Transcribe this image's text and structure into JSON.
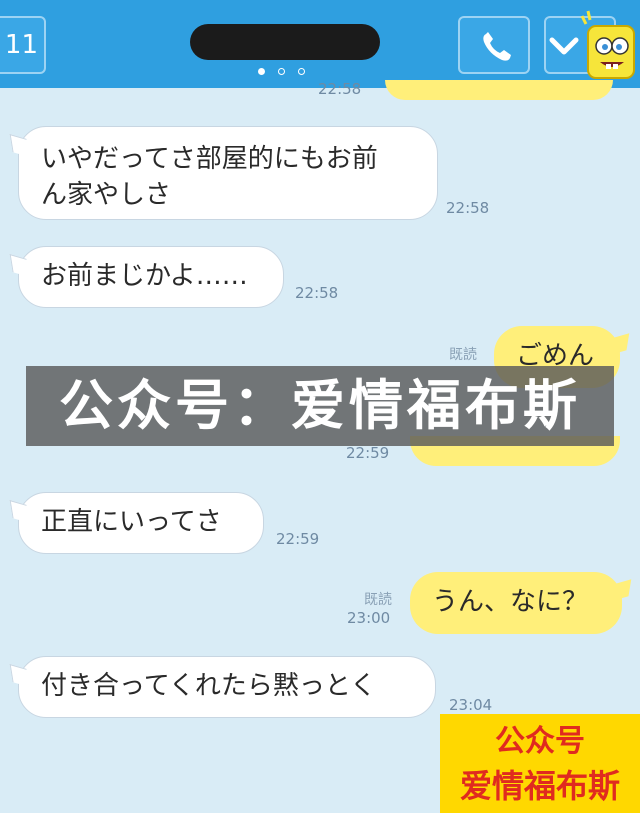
{
  "header": {
    "back_label": "11",
    "page_dots": 3,
    "active_dot": 0
  },
  "messages": [
    {
      "side": "right",
      "partial": true,
      "time": "22:58"
    },
    {
      "side": "left",
      "text_line1": "いやだってさ部屋的にもお前",
      "text_line2": "ん家やしさ",
      "time": "22:58"
    },
    {
      "side": "left",
      "text": "お前まじかよ……",
      "time": "22:58"
    },
    {
      "side": "right",
      "text": "ごめん",
      "read": "既読",
      "time": "22:59"
    },
    {
      "side": "left",
      "text": "正直にいってさ",
      "time": "22:59"
    },
    {
      "side": "right",
      "text": "うん、なに？",
      "read": "既読",
      "time": "23:00"
    },
    {
      "side": "left",
      "text": "付き合ってくれたら黙っとく",
      "time": "23:04"
    }
  ],
  "watermark": "公众号：爱情福布斯",
  "logo": {
    "line1": "公众号",
    "line2": "爱情福布斯"
  },
  "colors": {
    "header": "#2f9fe0",
    "background": "#d9ecf6",
    "bubble_right": "#ffef7a",
    "bubble_left": "#ffffff"
  }
}
